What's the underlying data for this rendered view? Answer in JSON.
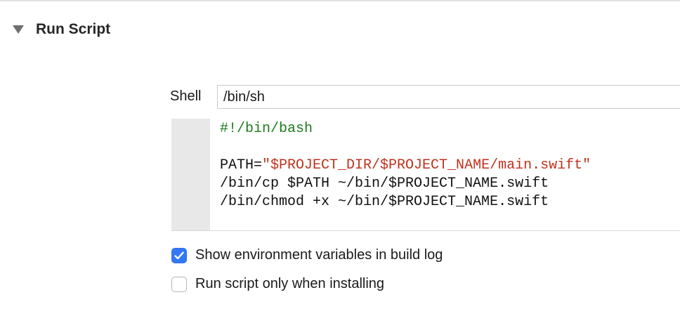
{
  "phase": {
    "title": "Run Script",
    "icon": "disclosure-triangle-down-icon"
  },
  "shell": {
    "label": "Shell",
    "value": "/bin/sh"
  },
  "script": {
    "line1": "#!/bin/bash",
    "line2": "",
    "line3_prefix": "PATH=",
    "line3_string": "\"$PROJECT_DIR/$PROJECT_NAME/main.swift\"",
    "line4": "/bin/cp $PATH ~/bin/$PROJECT_NAME.swift",
    "line5": "/bin/chmod +x ~/bin/$PROJECT_NAME.swift"
  },
  "options": {
    "show_env_vars": {
      "label": "Show environment variables in build log",
      "checked": true
    },
    "run_only_installing": {
      "label": "Run script only when installing",
      "checked": false
    }
  },
  "colors": {
    "accent": "#3478f6",
    "comment": "#1e7a1e",
    "string": "#c0321d"
  }
}
